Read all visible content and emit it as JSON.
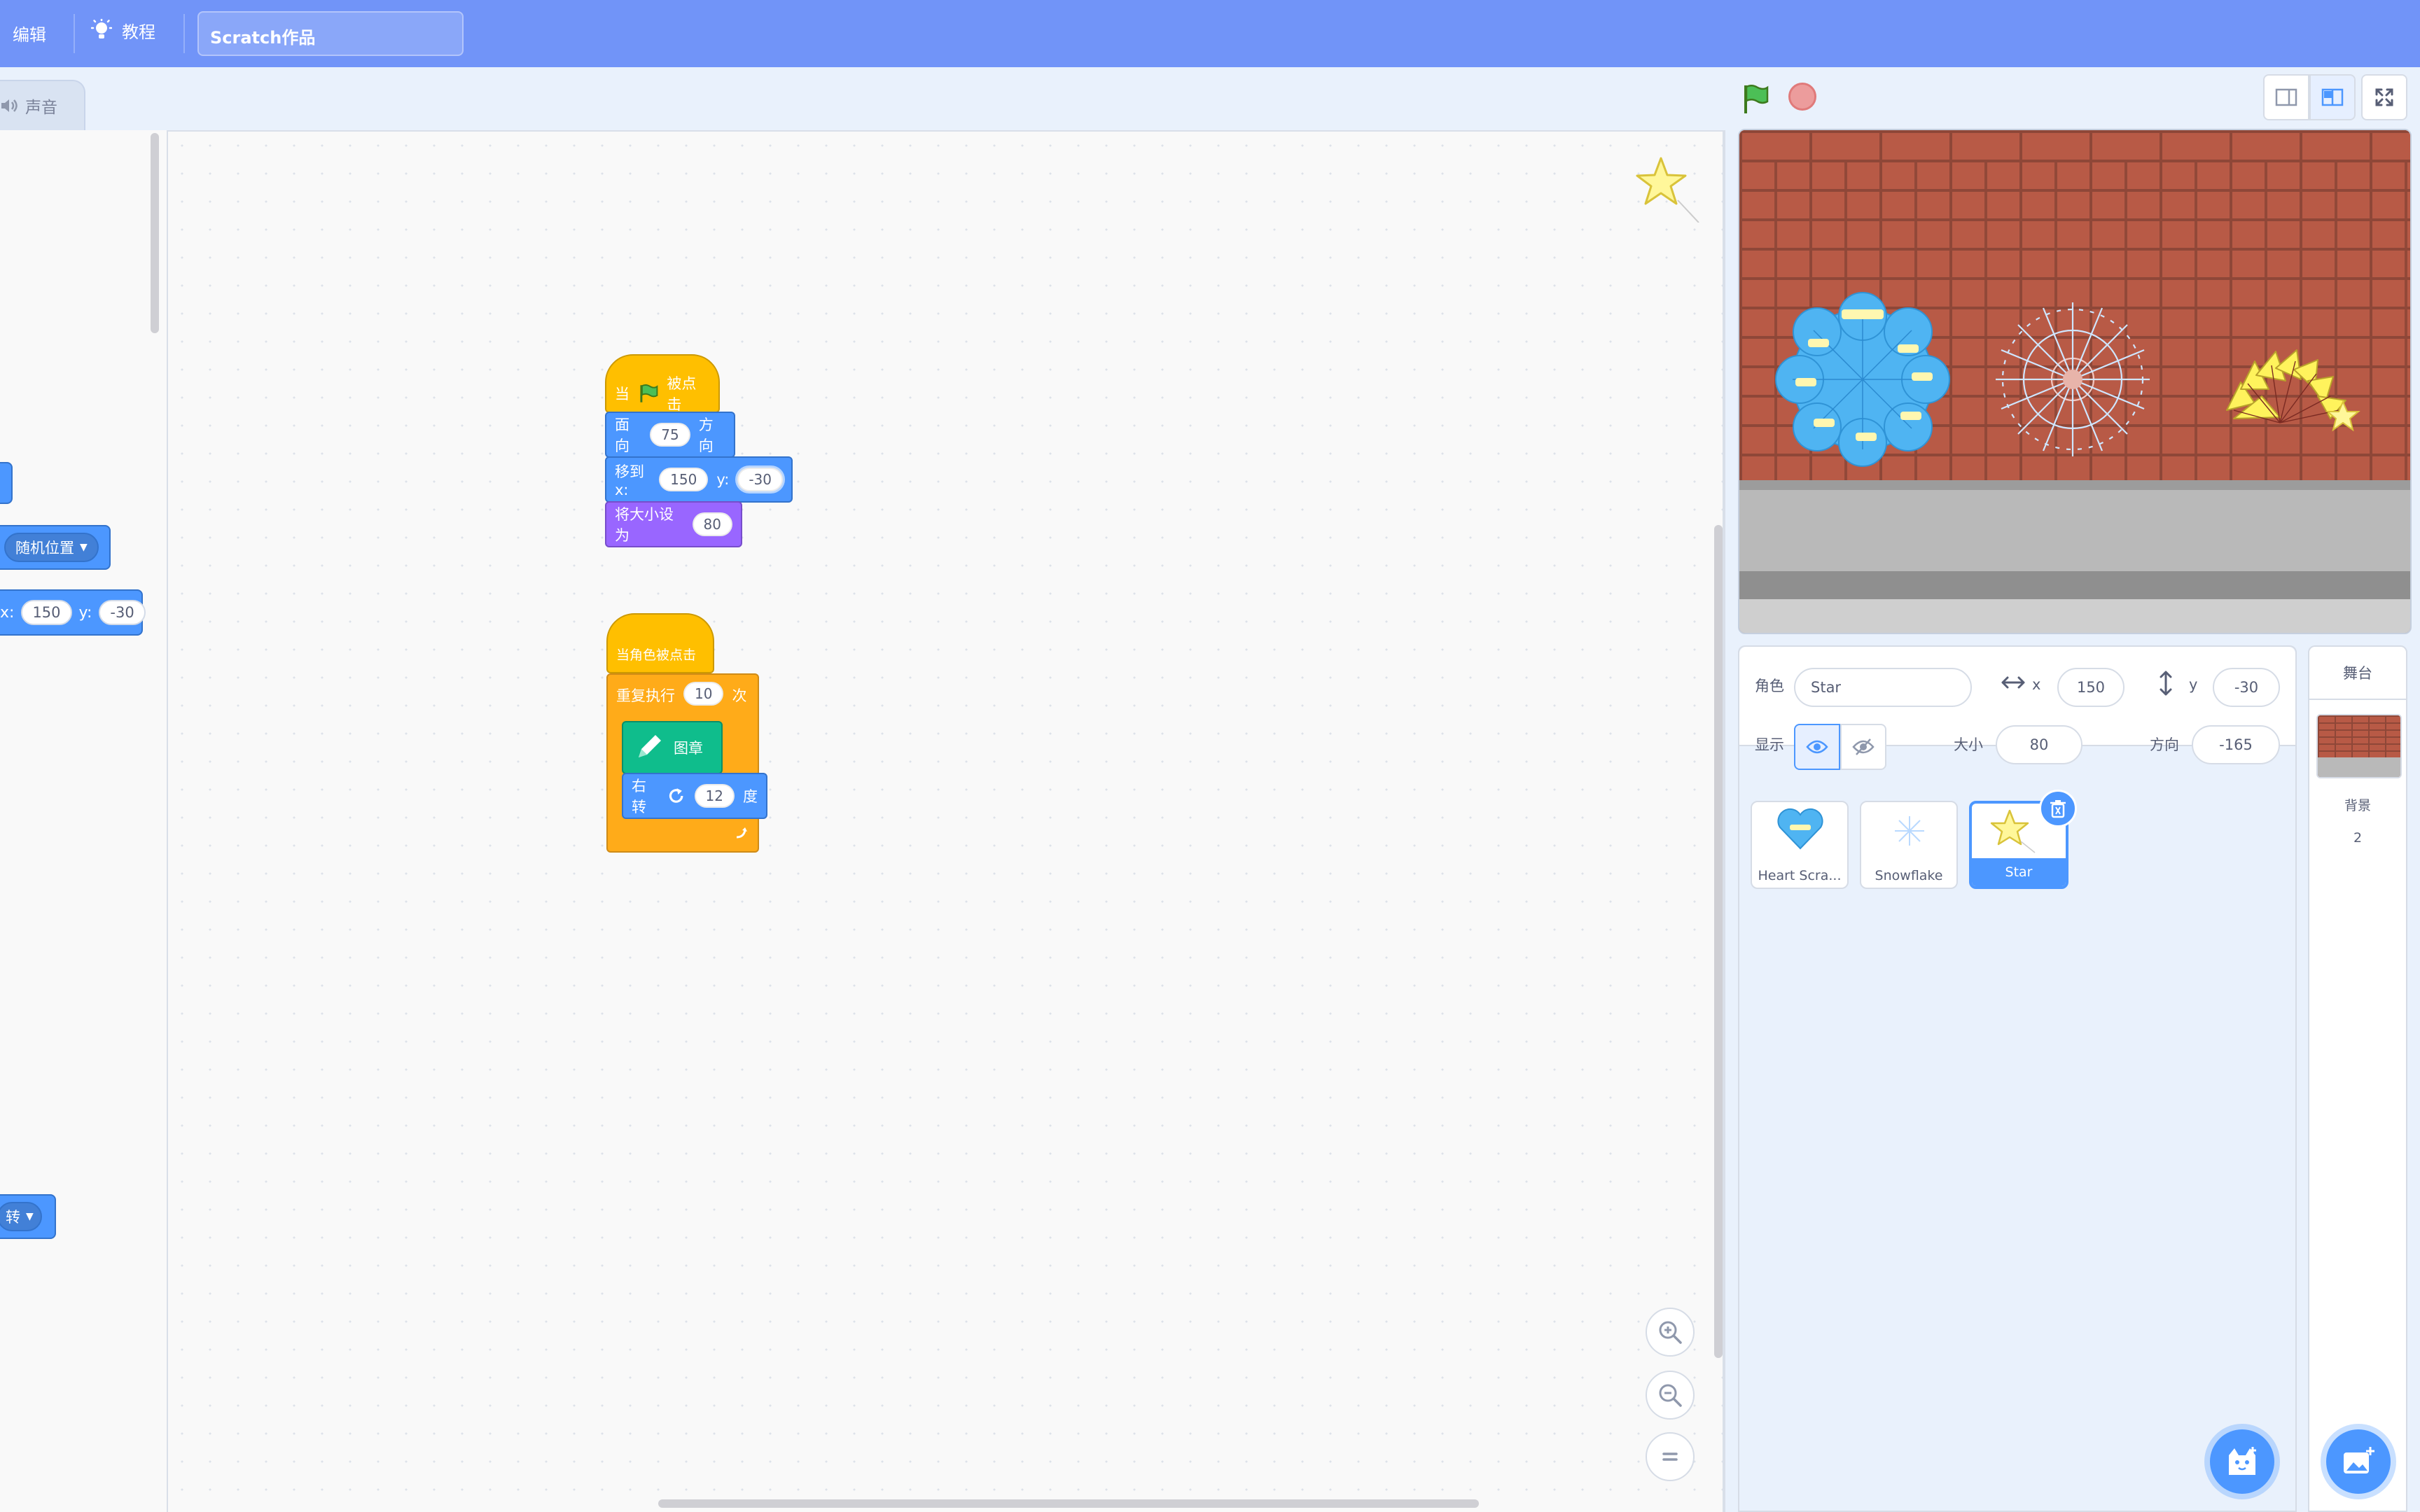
{
  "menubar": {
    "edit_label": "编辑",
    "tutorial_label": "教程",
    "project_title": "Scratch作品"
  },
  "tabs": {
    "sound_label": "声音"
  },
  "palette": {
    "goto_random_label": "随机位置",
    "glide_x_prefix": "x:",
    "glide_x": "150",
    "glide_y_label": "y:",
    "glide_y": "-30",
    "rotation_label": "转"
  },
  "scripts": {
    "script1": {
      "hat_when": "当",
      "hat_clicked": "被点击",
      "point_label": "面向",
      "point_value": "75",
      "point_unit": "方向",
      "goto_label": "移到 x:",
      "goto_x": "150",
      "goto_y_label": "y:",
      "goto_y": "-30",
      "size_label": "将大小设为",
      "size_value": "80"
    },
    "script2": {
      "hat_label": "当角色被点击",
      "repeat_label": "重复执行",
      "repeat_value": "10",
      "repeat_unit": "次",
      "stamp_label": "图章",
      "turn_label": "右转",
      "turn_value": "12",
      "turn_unit": "度"
    }
  },
  "sprite_info": {
    "sprite_label": "角色",
    "sprite_name": "Star",
    "x_label": "x",
    "x_value": "150",
    "y_label": "y",
    "y_value": "-30",
    "show_label": "显示",
    "size_label": "大小",
    "size_value": "80",
    "direction_label": "方向",
    "direction_value": "-165"
  },
  "sprites": [
    {
      "name": "Heart Scra..."
    },
    {
      "name": "Snowflake"
    },
    {
      "name": "Star"
    }
  ],
  "stage_selector": {
    "header": "舞台",
    "backdrop_label": "背景",
    "backdrop_count": "2"
  },
  "colors": {
    "menubar": "#7194f8",
    "motion": "#4c97ff",
    "events": "#ffbf00",
    "looks": "#9966ff",
    "control": "#ffab19",
    "pen": "#0fbd8c"
  }
}
